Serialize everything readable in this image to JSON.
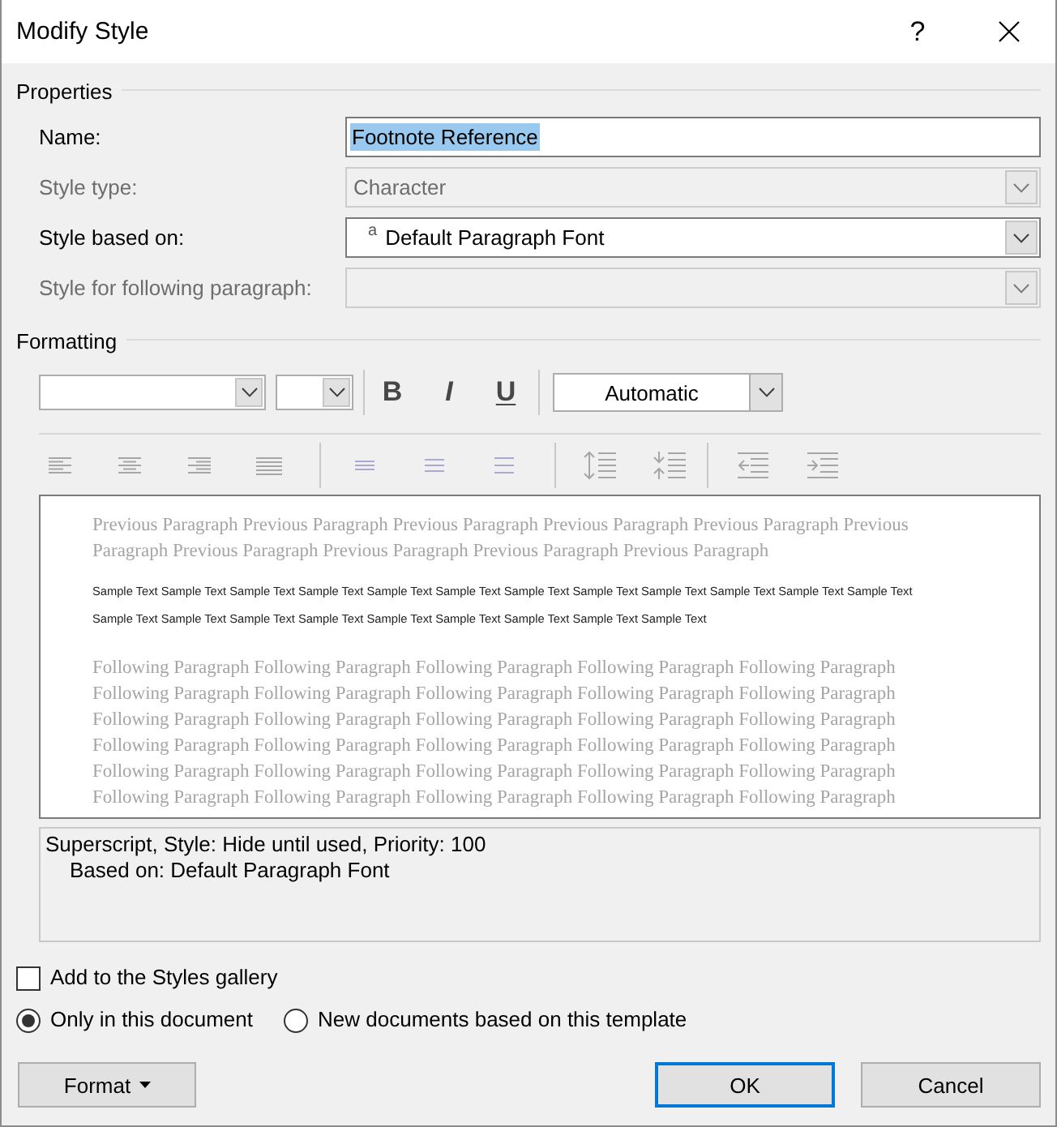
{
  "window": {
    "title": "Modify Style",
    "help_label": "?"
  },
  "properties": {
    "heading": "Properties",
    "fields": [
      {
        "kind": "text",
        "label": "Name:",
        "value": "Footnote Reference",
        "text_selected": true,
        "disabled": false
      },
      {
        "kind": "dropdown",
        "label": "Style type:",
        "value": "Character",
        "disabled": true
      },
      {
        "kind": "dropdown",
        "label": "Style based on:",
        "glyph": "a",
        "value": "Default Paragraph Font",
        "disabled": false
      },
      {
        "kind": "dropdown",
        "label": "Style for following paragraph:",
        "disabled": true
      }
    ]
  },
  "formatting": {
    "heading": "Formatting",
    "text_buttons": [
      {
        "kind": "bold",
        "label": "B"
      },
      {
        "kind": "italic",
        "label": "I"
      },
      {
        "kind": "underline",
        "label": "U"
      }
    ],
    "color": {
      "value": "Automatic"
    },
    "paragraph_groups": [
      {
        "buttons": [
          {
            "kind": "align-left",
            "disabled": true
          },
          {
            "kind": "align-center",
            "disabled": true
          },
          {
            "kind": "align-right",
            "disabled": true
          },
          {
            "kind": "justify",
            "disabled": true
          }
        ]
      },
      {
        "buttons": [
          {
            "kind": "line-single",
            "disabled": true
          },
          {
            "kind": "line-onehalf",
            "disabled": true
          },
          {
            "kind": "line-double",
            "disabled": true
          }
        ]
      },
      {
        "buttons": [
          {
            "kind": "space-increase",
            "disabled": true
          },
          {
            "kind": "space-decrease",
            "disabled": true
          }
        ]
      },
      {
        "buttons": [
          {
            "kind": "indent-decrease",
            "disabled": true
          },
          {
            "kind": "indent-increase",
            "disabled": true
          }
        ]
      }
    ]
  },
  "preview": {
    "previous_paragraph": "Previous Paragraph Previous Paragraph Previous Paragraph Previous Paragraph Previous Paragraph Previous Paragraph Previous Paragraph Previous Paragraph Previous Paragraph Previous Paragraph",
    "sample_text": "Sample Text Sample Text Sample Text Sample Text Sample Text Sample Text Sample Text Sample Text Sample Text Sample Text Sample Text Sample Text Sample Text Sample Text Sample Text Sample Text Sample Text Sample Text Sample Text Sample Text Sample Text",
    "following_paragraph": "Following Paragraph Following Paragraph Following Paragraph Following Paragraph Following Paragraph Following Paragraph Following Paragraph Following Paragraph Following Paragraph Following Paragraph Following Paragraph Following Paragraph Following Paragraph Following Paragraph Following Paragraph Following Paragraph Following Paragraph Following Paragraph Following Paragraph Following Paragraph Following Paragraph Following Paragraph Following Paragraph Following Paragraph Following Paragraph Following Paragraph Following Paragraph Following Paragraph Following Paragraph Following Paragraph"
  },
  "description": {
    "summary": "Superscript, Style: Hide until used, Priority: 100",
    "based_on": "Based on: Default Paragraph Font"
  },
  "add_to_gallery": {
    "label": "Add to the Styles gallery",
    "checked": false
  },
  "scope": [
    {
      "label": "Only in this document",
      "selected": true
    },
    {
      "label": "New documents based on this template",
      "selected": false
    }
  ],
  "buttons": [
    {
      "kind": "menu",
      "label": "Format"
    },
    {
      "kind": "default",
      "label": "OK"
    },
    {
      "kind": "plain",
      "label": "Cancel"
    }
  ]
}
